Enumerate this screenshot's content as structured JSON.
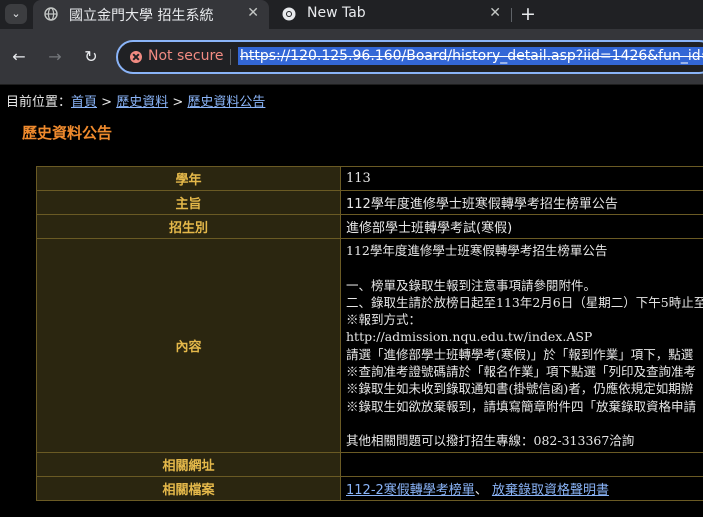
{
  "browser": {
    "tabs": [
      {
        "title": "國立金門大學 招生系統",
        "active": true
      },
      {
        "title": "New Tab",
        "active": false
      }
    ],
    "security_label": "Not secure",
    "url": "https://120.125.96.160/Board/history_detail.asp?iid=1426&fun_id="
  },
  "breadcrumb": {
    "prefix": "目前位置：",
    "items": [
      "首頁",
      "歷史資料",
      "歷史資料公告"
    ],
    "separator": " > "
  },
  "page_title": "歷史資料公告",
  "record": {
    "year_label": "學年",
    "year_value": "113",
    "subject_label": "主旨",
    "subject_value": "112學年度進修學士班寒假轉學考招生榜單公告",
    "category_label": "招生別",
    "category_value": "進修部學士班轉學考試(寒假)",
    "content_label": "內容",
    "content_lines": [
      "112學年度進修學士班寒假轉學考招生榜單公告",
      "",
      "一、榜單及錄取生報到注意事項請參閱附件。",
      "二、錄取生請於放榜日起至113年2月6日（星期二）下午5時止至",
      "※報到方式：",
      "http://admission.nqu.edu.tw/index.ASP",
      "請選「進修部學士班轉學考(寒假)」於「報到作業」項下，點選",
      "※查詢准考證號碼請於「報名作業」項下點選「列印及查詢准考",
      "※錄取生如未收到錄取通知書(掛號信函)者，仍應依規定如期辦",
      "※錄取生如欲放棄報到，請填寫簡章附件四「放棄錄取資格申請",
      "",
      "其他相關問題可以撥打招生專線：082-313367洽詢"
    ],
    "related_url_label": "相關網址",
    "related_url_value": "",
    "related_files_label": "相關檔案",
    "related_files": [
      "112-2寒假轉學考榜單",
      "放棄錄取資格聲明書"
    ],
    "files_separator": "、"
  }
}
